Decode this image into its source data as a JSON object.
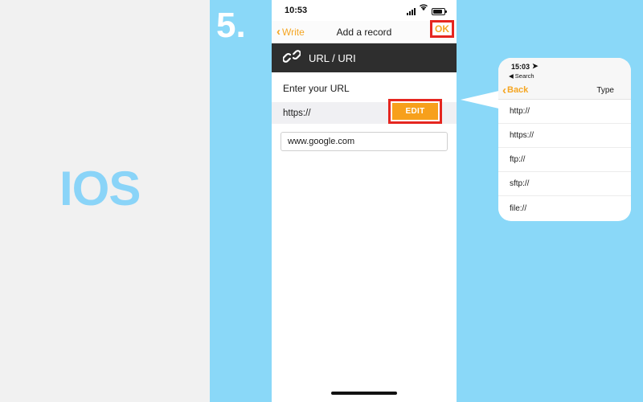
{
  "platform_label": "IOS",
  "step": {
    "number": "5."
  },
  "colors": {
    "band_blue": "#8ad8f8",
    "accent_orange": "#f5a623",
    "button_orange": "#f7a01c",
    "highlight_red": "#e52620",
    "header_dark": "#2e2e2e",
    "os_label_blue": "#8ad4f8"
  },
  "phone": {
    "statusbar": {
      "clock": "10:53",
      "signal_icon": "signal-bars-icon",
      "wifi_icon": "wifi-icon",
      "battery_icon": "battery-icon"
    },
    "navbar": {
      "back_chevron": "‹",
      "back_label": "Write",
      "title": "Add a record",
      "ok_label": "OK"
    },
    "type_header": {
      "icon": "link-chain-icon",
      "label": "URL / URI"
    },
    "form": {
      "field_label": "Enter your URL",
      "scheme_value": "https://",
      "edit_button_label": "EDIT",
      "url_value": "www.google.com",
      "url_placeholder": "www.google.com"
    }
  },
  "popup": {
    "statusbar": {
      "clock": "15:03",
      "location_icon": "location-arrow-icon",
      "back_app_arrow": "◀",
      "back_app_label": "Search"
    },
    "navbar": {
      "back_chevron": "‹",
      "back_label": "Back",
      "title": "Type"
    },
    "items": [
      {
        "label": "http://"
      },
      {
        "label": "https://"
      },
      {
        "label": "ftp://"
      },
      {
        "label": "sftp://"
      },
      {
        "label": "file://"
      }
    ]
  }
}
